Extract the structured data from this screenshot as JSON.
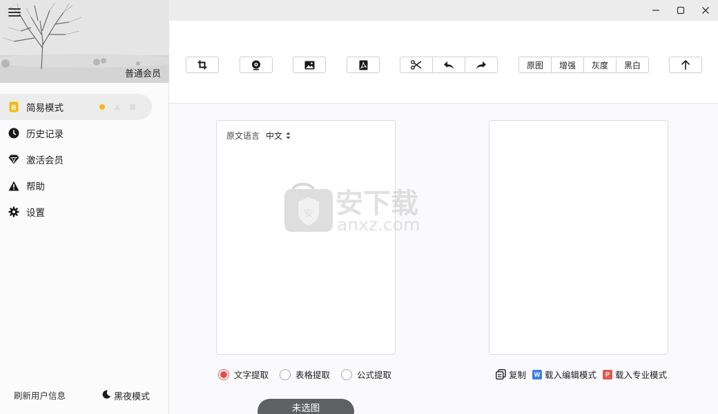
{
  "sidebar": {
    "member_label": "普通会员",
    "items": [
      {
        "label": "简易模式",
        "icon": "b-badge-icon",
        "active": true
      },
      {
        "label": "历史记录",
        "icon": "clock-icon"
      },
      {
        "label": "激活会员",
        "icon": "diamond-icon"
      },
      {
        "label": "帮助",
        "icon": "warning-icon"
      },
      {
        "label": "设置",
        "icon": "gear-icon"
      }
    ],
    "refresh_label": "刷新用户信息",
    "dark_mode_label": "黑夜模式",
    "active_badge_letter": "B"
  },
  "toolbar": {
    "filters": [
      "原图",
      "增强",
      "灰度",
      "黑白"
    ],
    "icons": [
      "crop-icon",
      "webcam-icon",
      "image-icon",
      "pdf-icon",
      "scissors-icon",
      "undo-icon",
      "redo-icon",
      "upload-icon"
    ]
  },
  "content": {
    "source_lang_label": "原文语言",
    "source_lang_value": "中文",
    "modes": [
      {
        "label": "文字提取",
        "selected": true
      },
      {
        "label": "表格提取",
        "selected": false
      },
      {
        "label": "公式提取",
        "selected": false
      }
    ],
    "actions": {
      "copy": "复制",
      "edit_mode": "载入编辑模式",
      "edit_badge": "W",
      "pro_mode": "载入专业模式",
      "pro_badge": "P"
    },
    "primary_button": "未选图"
  },
  "watermark": {
    "cn": "安下载",
    "en": "anxz.com",
    "shield_char": "安"
  },
  "colors": {
    "accent_yellow": "#f2bb16",
    "radio_red": "#e74c4c",
    "word_blue": "#3d7ee6",
    "pdf_red": "#e05a4f",
    "button_dark": "#5f6064"
  }
}
